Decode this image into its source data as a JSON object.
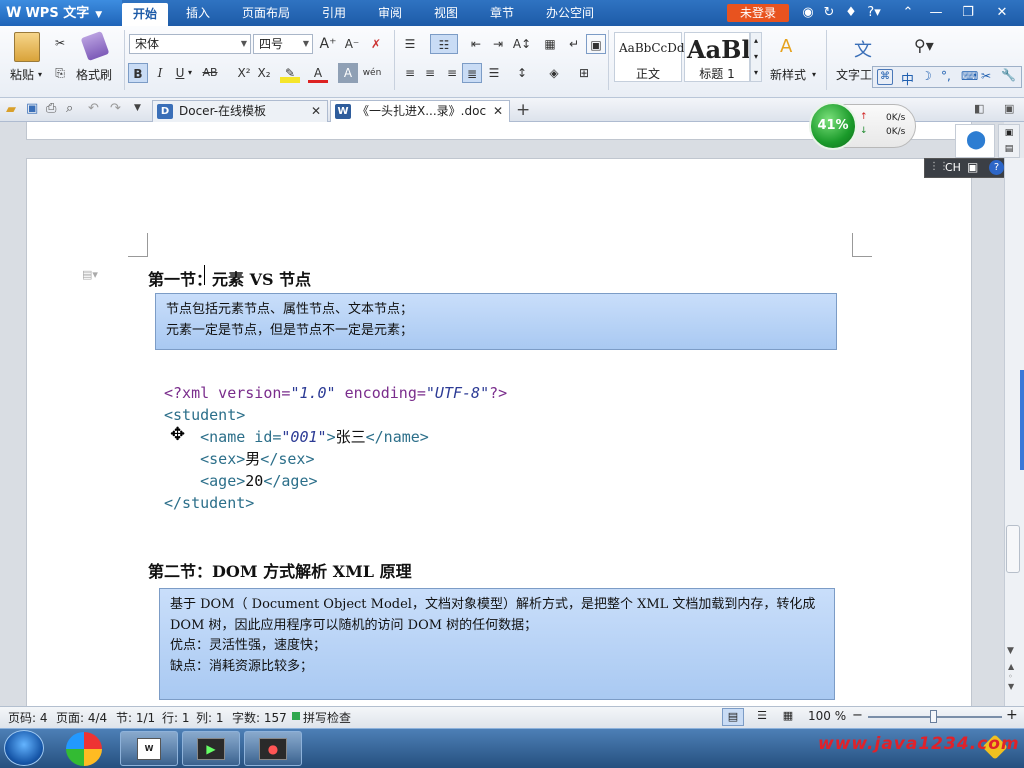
{
  "titlebar": {
    "app_name": "WPS 文字",
    "tabs": [
      "开始",
      "插入",
      "页面布局",
      "引用",
      "审阅",
      "视图",
      "章节",
      "办公空间"
    ],
    "login_label": "未登录",
    "help": "?"
  },
  "ribbon": {
    "paste_label": "粘贴",
    "format_painter_label": "格式刷",
    "font_name": "宋体",
    "font_size": "四号",
    "bold": "B",
    "italic": "I",
    "underline": "U",
    "strike": "AB",
    "superscript": "X²",
    "subscript": "X₂",
    "font_color": "A",
    "styles": [
      {
        "preview": "AaBbCcDd",
        "label": "正文"
      },
      {
        "preview": "AaBl",
        "label": "标题 1"
      }
    ],
    "new_style_label": "新样式",
    "text_tools_label": "文字工"
  },
  "ime_bar": {
    "items": [
      "中",
      "☽",
      "°,",
      "⌨",
      "✂",
      "🔧"
    ]
  },
  "ime_bar2": {
    "mode": "CH"
  },
  "tabs": [
    {
      "label": "Docer-在线模板",
      "active": false
    },
    {
      "label": "《一头扎进X...录》.doc",
      "active": true
    }
  ],
  "network": {
    "percent": "41%",
    "up": "0K/s",
    "down": "0K/s"
  },
  "document": {
    "section1_title": "第一节：元素 VS 节点",
    "section1_note": [
      "节点包括元素节点、属性节点、文本节点；",
      "元素一定是节点，但是节点不一定是元素；"
    ],
    "code": {
      "decl_prefix": "<?xml version=",
      "decl_version": "\"1.0\"",
      "decl_mid": " encoding=",
      "decl_encoding": "\"UTF-8\"",
      "decl_suffix": "?>",
      "student_open": "<student>",
      "name_open": "<name id=",
      "name_id": "\"001\"",
      "name_gt": ">",
      "name_text": "张三",
      "name_close": "</name>",
      "sex_open": "<sex>",
      "sex_text": "男",
      "sex_close": "</sex>",
      "age_open": "<age>",
      "age_text": "20",
      "age_close": "</age>",
      "student_close": "</student>"
    },
    "section2_title": "第二节：DOM 方式解析 XML 原理",
    "section2_note": [
      "基于 DOM（ Document Object Model，文档对象模型）解析方式，是把整个 XML 文档加载到内存，转化成",
      "DOM 树，因此应用程序可以随机的访问 DOM 树的任何数据；",
      "优点：灵活性强，速度快；",
      "缺点：消耗资源比较多；"
    ]
  },
  "statusbar": {
    "page_no": "页码: 4",
    "page": "页面: 4/4",
    "section": "节: 1/1",
    "row": "行: 1",
    "col": "列: 1",
    "words": "字数: 157",
    "spell": "拼写检查",
    "zoom": "100 %"
  },
  "taskbar": {
    "watermark": "www.java1234.com"
  }
}
